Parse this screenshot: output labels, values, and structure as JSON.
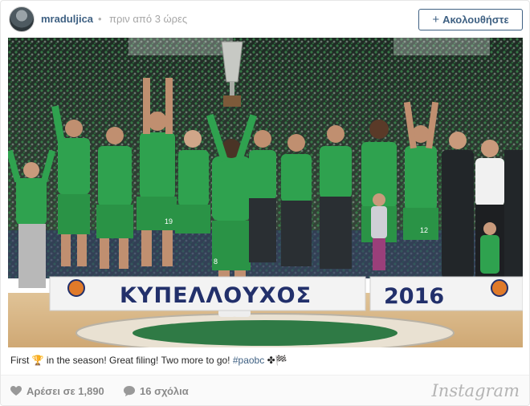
{
  "post": {
    "username": "mraduljica",
    "separator": "•",
    "time_ago": "πριν από 3 ώρες",
    "follow_label": "Ακολουθήστε",
    "follow_icon": "plus-icon"
  },
  "photo": {
    "banner_left": "ΚΥΠΕΛΛΟΥΧΟΣ",
    "banner_year": "2016",
    "jersey_numbers": [
      "19",
      "12",
      "8"
    ],
    "colors": {
      "jersey_green": "#2fa24f",
      "dark_green": "#0e5a2c",
      "banner_navy": "#22306b",
      "floor": "#d9b98a"
    }
  },
  "caption": {
    "text": "First 🏆 in the season! Great filing! Two more to go!",
    "hashtag": "#paobc",
    "emoji_tail": "✤🏁"
  },
  "footer": {
    "likes_text": "Αρέσει σε 1,890",
    "comments_text": "16 σχόλια",
    "brand": "Instagram",
    "like_icon": "heart-icon",
    "comment_icon": "comment-bubble-icon"
  }
}
